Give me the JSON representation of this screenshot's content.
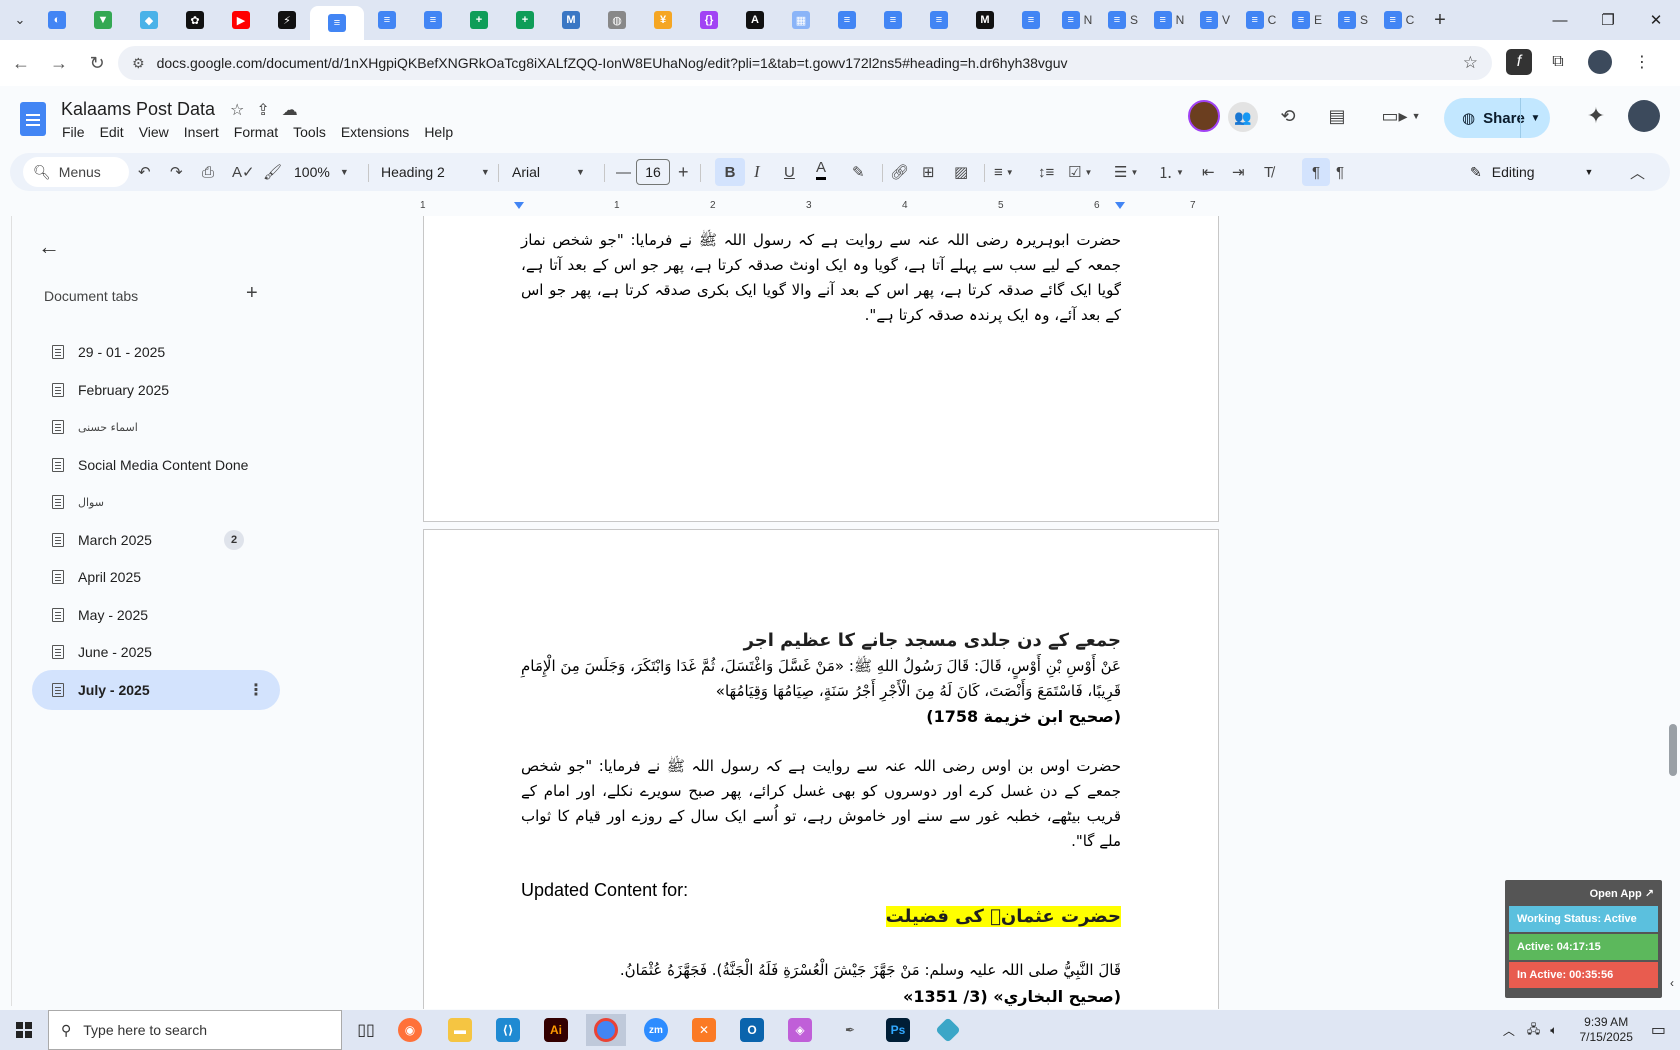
{
  "browser": {
    "tabs": [
      {
        "icon": "lens-icon",
        "color": "#4285f4",
        "glyph": "◐"
      },
      {
        "icon": "vpn-icon",
        "color": "#34a853",
        "glyph": "▼"
      },
      {
        "icon": "extension-icon",
        "color": "#4ab2e8",
        "glyph": "◆"
      },
      {
        "icon": "openai-icon",
        "color": "#111111",
        "glyph": "✿"
      },
      {
        "icon": "youtube-icon",
        "color": "#ff0000",
        "glyph": "▶"
      },
      {
        "icon": "bolt-icon",
        "color": "#111111",
        "glyph": "⚡"
      },
      {
        "icon": "docs-icon",
        "color": "#4285f4",
        "glyph": "≡",
        "active": true
      },
      {
        "icon": "docs-icon",
        "color": "#4285f4",
        "glyph": "≡"
      },
      {
        "icon": "docs-icon",
        "color": "#4285f4",
        "glyph": "≡"
      },
      {
        "icon": "sheets-icon",
        "color": "#0f9d58",
        "glyph": "+"
      },
      {
        "icon": "sheets-icon",
        "color": "#0f9d58",
        "glyph": "+"
      },
      {
        "icon": "wordpress-icon",
        "color": "#3a77c4",
        "glyph": "M"
      },
      {
        "icon": "globe-icon",
        "color": "#888888",
        "glyph": "◍"
      },
      {
        "icon": "feather-icon",
        "color": "#f5a623",
        "glyph": "¥"
      },
      {
        "icon": "code-icon",
        "color": "#a142f4",
        "glyph": "{}"
      },
      {
        "icon": "ai-icon",
        "color": "#111111",
        "glyph": "A"
      },
      {
        "icon": "grid-icon",
        "color": "#8ab4f8",
        "glyph": "▦"
      },
      {
        "icon": "forms-icon",
        "color": "#4285f4",
        "glyph": "≡"
      },
      {
        "icon": "forms-icon",
        "color": "#4285f4",
        "glyph": "≡"
      },
      {
        "icon": "forms-icon",
        "color": "#4285f4",
        "glyph": "≡"
      },
      {
        "icon": "medium-icon",
        "color": "#111111",
        "glyph": "M"
      },
      {
        "icon": "forms-icon",
        "color": "#4285f4",
        "glyph": "≡"
      },
      {
        "icon": "forms-icon",
        "color": "#4285f4",
        "glyph": "≡",
        "label": "N"
      },
      {
        "icon": "forms-icon",
        "color": "#4285f4",
        "glyph": "≡",
        "label": "S"
      },
      {
        "icon": "forms-icon",
        "color": "#4285f4",
        "glyph": "≡",
        "label": "N"
      },
      {
        "icon": "forms-icon",
        "color": "#4285f4",
        "glyph": "≡",
        "label": "V"
      },
      {
        "icon": "forms-icon",
        "color": "#4285f4",
        "glyph": "≡",
        "label": "C"
      },
      {
        "icon": "forms-icon",
        "color": "#4285f4",
        "glyph": "≡",
        "label": "E"
      },
      {
        "icon": "forms-icon",
        "color": "#4285f4",
        "glyph": "≡",
        "label": "S"
      },
      {
        "icon": "forms-icon",
        "color": "#4285f4",
        "glyph": "≡",
        "label": "C"
      }
    ],
    "url": "docs.google.com/document/d/1nXHgpiQKBefXNGRkOaTcg8iXALfZQQ-IonW8EUhaNog/edit?pli=1&tab=t.gowv172l2ns5#heading=h.dr6hyh38vguv"
  },
  "doc": {
    "title": "Kalaams Post Data",
    "menu": [
      "File",
      "Edit",
      "View",
      "Insert",
      "Format",
      "Tools",
      "Extensions",
      "Help"
    ],
    "share_label": "Share"
  },
  "toolbar": {
    "search_label": "Menus",
    "zoom": "100%",
    "style": "Heading 2",
    "font": "Arial",
    "font_size": "16",
    "mode": "Editing"
  },
  "ruler": {
    "ticks": [
      "1",
      "1",
      "2",
      "3",
      "4",
      "5",
      "6",
      "7"
    ]
  },
  "sidebar": {
    "heading": "Document tabs",
    "tabs": [
      {
        "label": "29 - 01 - 2025"
      },
      {
        "label": "February 2025"
      },
      {
        "label": "اسماء حسنی",
        "urdu": true
      },
      {
        "label": "Social Media Content Done"
      },
      {
        "label": "سوال",
        "urdu": true
      },
      {
        "label": "March 2025",
        "badge": "2"
      },
      {
        "label": "April 2025"
      },
      {
        "label": "May - 2025"
      },
      {
        "label": "June - 2025"
      },
      {
        "label": "July - 2025",
        "active": true
      }
    ]
  },
  "page1": {
    "paragraph": "حضرت ابوہریرہ رضی اللہ عنہ سے روایت ہے کہ رسول اللہ ﷺ نے فرمایا: \"جو شخص نماز جمعہ کے لیے سب سے پہلے آتا ہے، گویا وہ ایک اونٹ صدقہ کرتا ہے، پھر جو اس کے بعد آتا ہے، گویا ایک گائے صدقہ کرتا ہے، پھر اس کے بعد آنے والا گویا ایک بکری صدقہ کرتا ہے، پھر جو اس کے بعد آئے، وہ ایک پرندہ صدقہ کرتا ہے\"."
  },
  "page2": {
    "heading": "جمعے کے دن جلدی مسجد جانے کا عظیم اجر",
    "arabic": "عَنْ أَوْسِ بْنِ أَوْسٍ، قَالَ: قَالَ رَسُولُ اللهِ ﷺ: «مَنْ غَسَّلَ وَاغْتَسَلَ، ثُمَّ غَدَا وَابْتَكَرَ، وَجَلَسَ مِنَ الْإِمَامِ قَرِيبًا، فَاسْتَمَعَ وَأَنْصَتَ، كَانَ لَهُ مِنَ الْأَجْرِ أَجْرُ سَنَةٍ، صِيَامُهَا وَقِيَامُهَا»",
    "reference": "(صحیح ابن خزیمة 1758)",
    "translation": "حضرت اوس بن اوس رضی اللہ عنہ سے روایت ہے کہ رسول اللہ ﷺ نے فرمایا: \"جو شخص جمعے کے دن غسل کرے اور دوسروں کو بھی غسل کرائے، پھر صبح سویرے نکلے، اور امام کے قریب بیٹھے، خطبہ غور سے سنے اور خاموش رہے، تو اُسے ایک سال کے روزے اور قیام کا ثواب ملے گا\".",
    "updated_label": "Updated Content for:",
    "highlight_heading": "حضرت عثمانؓ کی فضیلت",
    "hadith": "قَالَ النَّبِيُّ صلی اللہ علیہ وسلم: مَنْ جَهَّزَ جَيْشَ الْعُسْرَةِ فَلَهُ الْجَنَّةُ). فَجَهَّزَهُ عُثْمَانُ.",
    "hadith_ref": "(صحیح البخاري» (3/ 1351»"
  },
  "widget": {
    "open_label": "Open App ↗",
    "status": "Working Status: Active",
    "active": "Active: 04:17:15",
    "inactive": "In Active: 00:35:56"
  },
  "taskbar": {
    "search_placeholder": "Type here to search",
    "time": "9:39 AM",
    "date": "7/15/2025"
  }
}
